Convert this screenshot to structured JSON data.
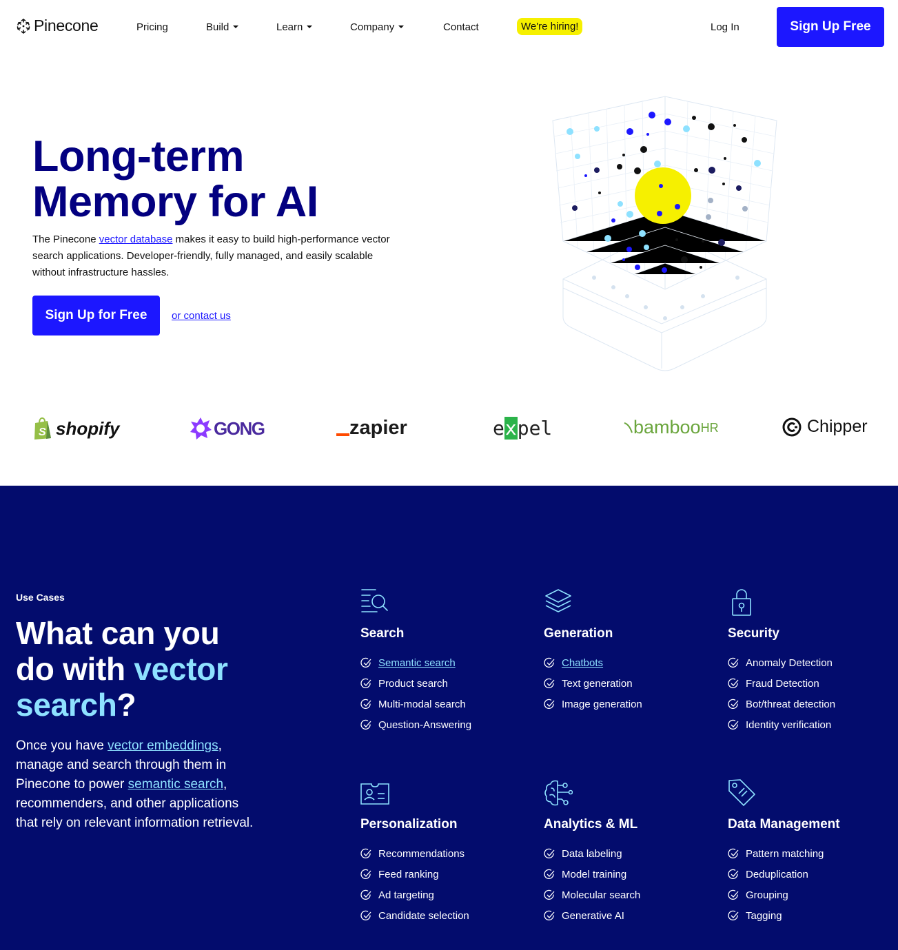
{
  "nav": {
    "logo_text": "Pinecone",
    "items": [
      {
        "label": "Pricing"
      },
      {
        "label": "Build"
      },
      {
        "label": "Learn"
      },
      {
        "label": "Company"
      },
      {
        "label": "Contact"
      }
    ],
    "hiring": "We're hiring!",
    "login": "Log In",
    "signup": "Sign Up Free"
  },
  "hero": {
    "title_line1": "Long-term",
    "title_line2": "Memory for AI",
    "desc_before": "The Pinecone ",
    "desc_link": "vector database",
    "desc_after": " makes it easy to build high-performance vector search applications. Developer-friendly, fully managed, and easily scalable without infrastructure hassles.",
    "cta": "Sign Up for Free",
    "contact": "or contact us"
  },
  "logos": {
    "shopify": "shopify",
    "gong": "GONG",
    "zapier": "zapier",
    "expel_e": "e",
    "expel_x": "x",
    "expel_rest": "pel",
    "bamboo": "bamboo",
    "bamboo_hr": "HR",
    "chipper": "Chipper"
  },
  "usecases": {
    "eyebrow": "Use Cases",
    "title_1": "What can you do with ",
    "title_hl": "vector search",
    "title_2": "?",
    "desc_1": "Once you have ",
    "desc_link1": "vector embeddings",
    "desc_2": ", manage and search through them in Pinecone to power ",
    "desc_link2": "semantic search",
    "desc_3": ", recommenders, and other applications that rely on relevant information retrieval.",
    "categories": [
      {
        "title": "Search",
        "icon": "search-list-icon",
        "items": [
          "Semantic search",
          "Product search",
          "Multi-modal search",
          "Question-Answering"
        ]
      },
      {
        "title": "Generation",
        "icon": "layers-icon",
        "items": [
          "Chatbots",
          "Text generation",
          "Image generation"
        ]
      },
      {
        "title": "Security",
        "icon": "lock-icon",
        "items": [
          "Anomaly Detection",
          "Fraud Detection",
          "Bot/threat detection",
          "Identity verification"
        ]
      },
      {
        "title": "Personalization",
        "icon": "id-card-icon",
        "items": [
          "Recommendations",
          "Feed ranking",
          "Ad targeting",
          "Candidate selection"
        ]
      },
      {
        "title": "Analytics & ML",
        "icon": "brain-circuit-icon",
        "items": [
          "Data labeling",
          "Model training",
          "Molecular search",
          "Generative AI"
        ]
      },
      {
        "title": "Data Management",
        "icon": "tag-icon",
        "items": [
          "Pattern matching",
          "Deduplication",
          "Grouping",
          "Tagging"
        ]
      }
    ]
  },
  "colors": {
    "brand_blue": "#1c17ff",
    "navy": "#030080",
    "section_bg": "#030c6d",
    "accent_cyan": "#8ee1ff",
    "hiring_yellow": "#f6f000"
  }
}
